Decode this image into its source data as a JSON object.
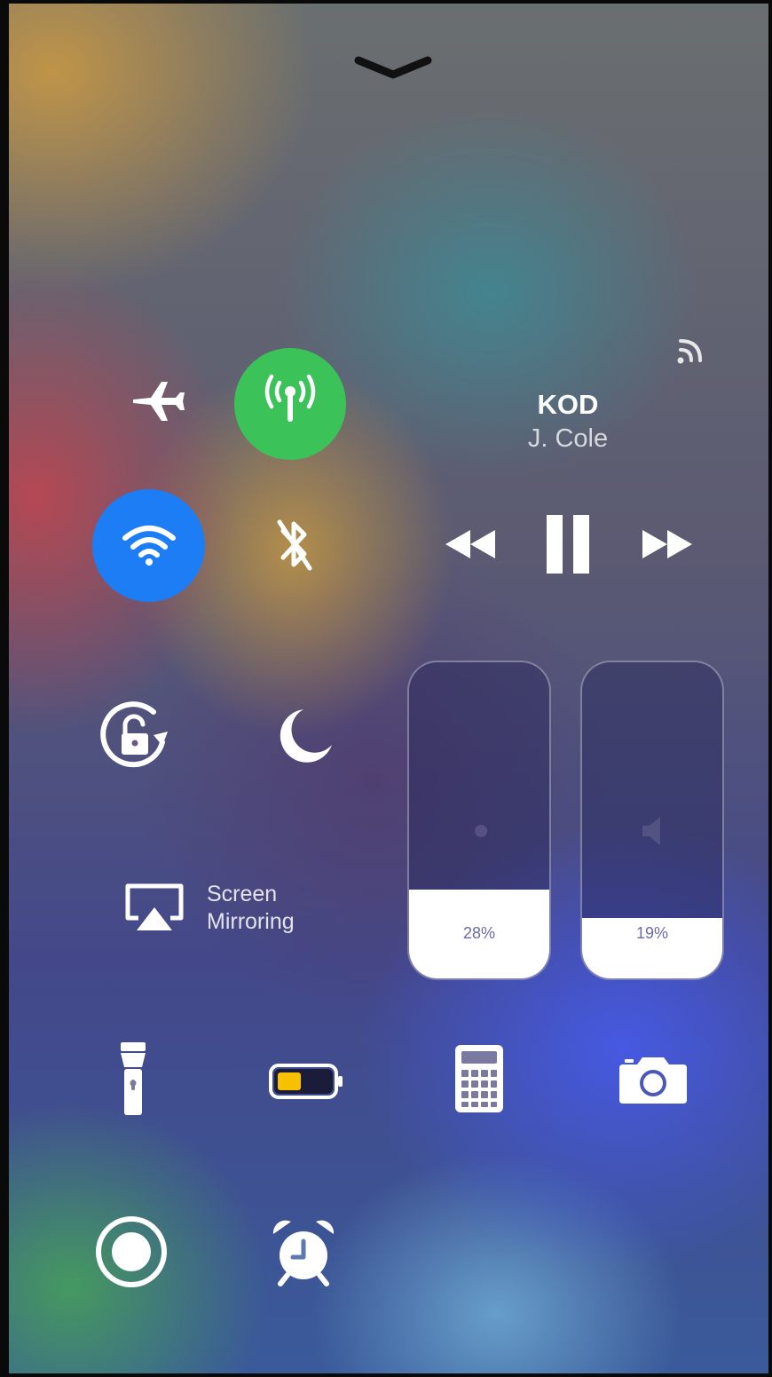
{
  "handle": {
    "icon": "chevron-down-icon"
  },
  "connectivity": {
    "airplane": {
      "icon": "airplane-icon",
      "active": false
    },
    "cellular": {
      "icon": "cellular-antenna-icon",
      "active": true,
      "color": "#3bc35a"
    },
    "wifi": {
      "icon": "wifi-icon",
      "active": true,
      "color": "#1d7df5"
    },
    "bluetooth": {
      "icon": "bluetooth-off-icon",
      "active": false
    }
  },
  "now_playing": {
    "airplay_icon": "airplay-audio-icon",
    "title": "KOD",
    "artist": "J. Cole",
    "controls": [
      "rewind-icon",
      "pause-icon",
      "fast-forward-icon"
    ]
  },
  "toggles": {
    "rotation_lock": {
      "icon": "rotation-lock-icon"
    },
    "do_not_disturb": {
      "icon": "moon-icon"
    }
  },
  "screen_mirroring": {
    "icon": "screen-mirroring-icon",
    "line1": "Screen",
    "line2": "Mirroring"
  },
  "sliders": {
    "brightness": {
      "icon": "sun-icon",
      "value": 0.28,
      "label": "28%"
    },
    "volume": {
      "icon": "speaker-icon",
      "value": 0.19,
      "label": "19%"
    }
  },
  "shortcuts": [
    {
      "icon": "flashlight-icon"
    },
    {
      "icon": "low-power-battery-icon",
      "color": "#f7c100"
    },
    {
      "icon": "calculator-icon"
    },
    {
      "icon": "camera-icon"
    },
    {
      "icon": "screen-record-icon"
    },
    {
      "icon": "alarm-clock-icon"
    }
  ]
}
